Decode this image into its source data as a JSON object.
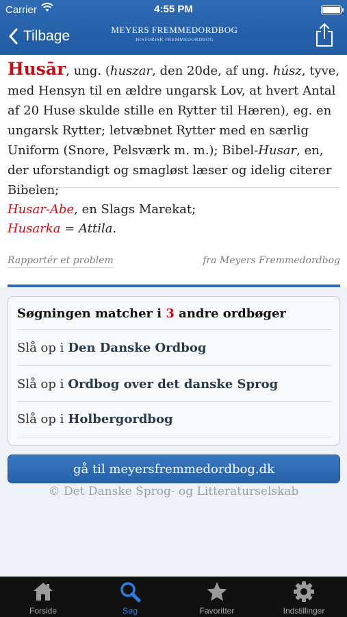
{
  "status": {
    "carrier": "Carrier",
    "time": "4:55 PM"
  },
  "nav": {
    "back_label": "Tilbage",
    "brand_name": "MEYERS FREMMEDORDBOG",
    "brand_sub": "HISTORISK FREMMEDORDBOG"
  },
  "entry": {
    "headword": "Husār",
    "p1": ", ung. (",
    "etym_word1": "huszar",
    "p2": ", den 20de, af ung. ",
    "etym_word2": "húsz",
    "p3": ", tyve, med Hensyn til en ældre ungarsk Lov, at hvert Antal af 20 Huse skulde stille en Rytter til Hæren), eg. en ungarsk Rytter; letvæbnet Rytter med en særlig Uniform (Snore, Pelsværk m. m.); Bibel-",
    "compound": "Husar",
    "p4": ", en, der uforstandigt og smagløst læser og idelig citerer Bibelen;"
  },
  "subentries": [
    {
      "term": "Husar-Abe",
      "rest": ", en Slags Marekat;"
    },
    {
      "term": "Husarka",
      "eq": " = ",
      "rest_italic": "Attila",
      "end": "."
    }
  ],
  "meta": {
    "report": "Rapportér et problem",
    "source": "fra Meyers Fremmedordbog"
  },
  "matches": {
    "title_pre": "Søgningen matcher i ",
    "count": "3",
    "title_post": " andre ordbøger",
    "prefix": "Slå op i",
    "items": [
      "Den Danske Ordbog",
      "Ordbog over det danske Sprog",
      "Holbergordbog"
    ]
  },
  "go_button": "gå til meyersfremmedordbog.dk",
  "copyright": "© Det Danske Sprog- og Litteraturselskab",
  "tabs": [
    {
      "label": "Forside",
      "icon": "house-icon"
    },
    {
      "label": "Søg",
      "icon": "search-icon"
    },
    {
      "label": "Favoritter",
      "icon": "star-icon"
    },
    {
      "label": "Indstillinger",
      "icon": "gear-icon"
    }
  ],
  "colors": {
    "nav": "#205aa2",
    "headword": "#c0121b",
    "tab_active": "#2f7de0"
  }
}
